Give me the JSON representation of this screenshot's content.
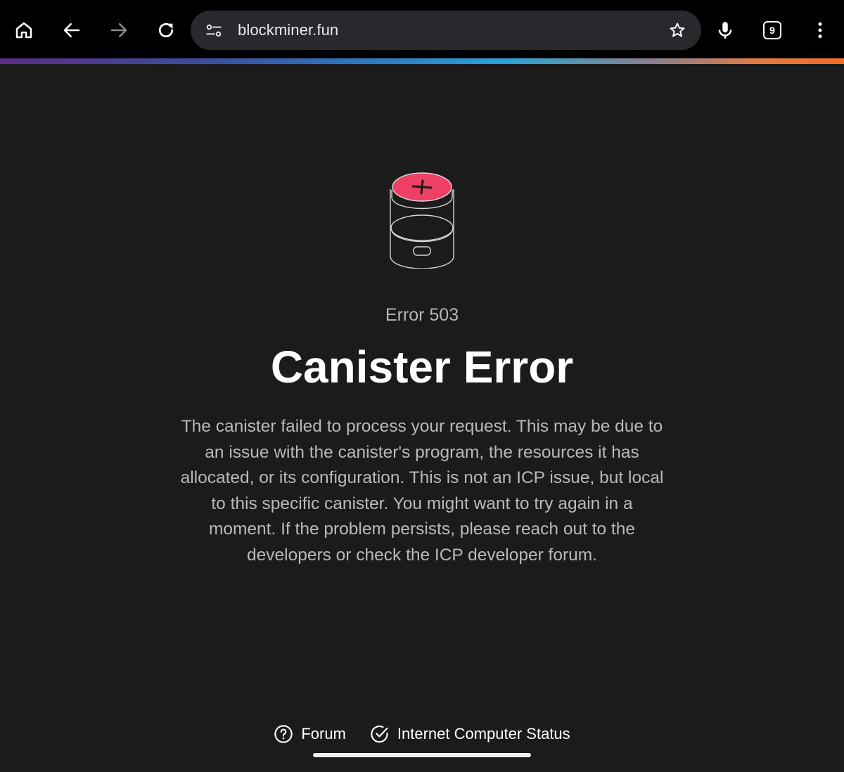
{
  "browser": {
    "url": "blockminer.fun",
    "tab_count": "9",
    "icons": {
      "home": "home-icon",
      "back": "back-arrow-icon",
      "forward": "forward-arrow-icon",
      "reload": "reload-icon",
      "site_settings": "tune-icon",
      "bookmark": "star-icon",
      "voice": "microphone-icon",
      "tabs": "tab-switcher-icon",
      "menu": "more-vert-icon"
    }
  },
  "page": {
    "illustration": "canister-error-icon",
    "error_code": "Error 503",
    "title": "Canister Error",
    "description": "The canister failed to process your request. This may be due to an issue with the canister's program, the resources it has allocated, or its configuration. This is not an ICP issue, but local to this specific canister. You might want to try again in a moment. If the problem persists, please reach out to the developers or check the ICP developer forum.",
    "accent_color": "#ee3f64"
  },
  "footer": {
    "links": [
      {
        "label": "Forum",
        "icon": "help-circle-icon"
      },
      {
        "label": "Internet Computer Status",
        "icon": "check-circle-icon"
      }
    ]
  }
}
